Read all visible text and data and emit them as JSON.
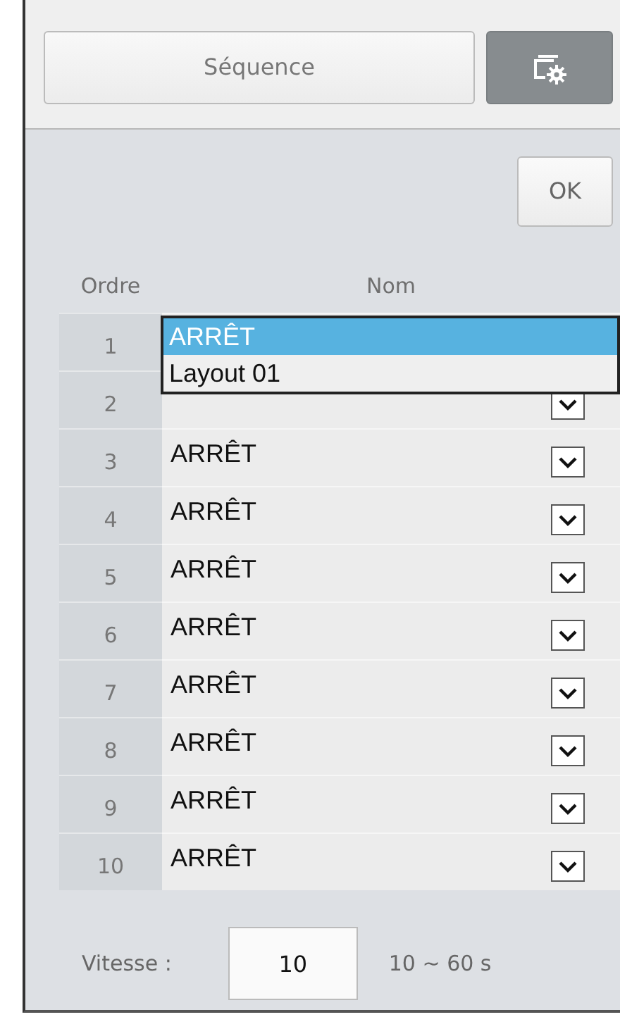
{
  "tabs": [
    {
      "label": "Séquence",
      "kind": "text",
      "selected": false
    },
    {
      "kind": "settings",
      "selected": true
    }
  ],
  "ok_button": "OK",
  "table": {
    "columns": [
      "Ordre",
      "Nom"
    ],
    "rows": [
      {
        "order": "1",
        "dropdown_open": true,
        "options": [
          {
            "label": "ARRÊT",
            "selected": true
          },
          {
            "label": "Layout 01",
            "selected": false
          }
        ]
      },
      {
        "order": "2"
      },
      {
        "order": "3",
        "name": "ARRÊT"
      },
      {
        "order": "4",
        "name": "ARRÊT"
      },
      {
        "order": "5",
        "name": "ARRÊT"
      },
      {
        "order": "6",
        "name": "ARRÊT"
      },
      {
        "order": "7",
        "name": "ARRÊT"
      },
      {
        "order": "8",
        "name": "ARRÊT"
      },
      {
        "order": "9",
        "name": "ARRÊT"
      },
      {
        "order": "10",
        "name": "ARRÊT"
      }
    ]
  },
  "speed": {
    "label": "Vitesse :",
    "value": "10",
    "range": "10 ~ 60 s"
  }
}
